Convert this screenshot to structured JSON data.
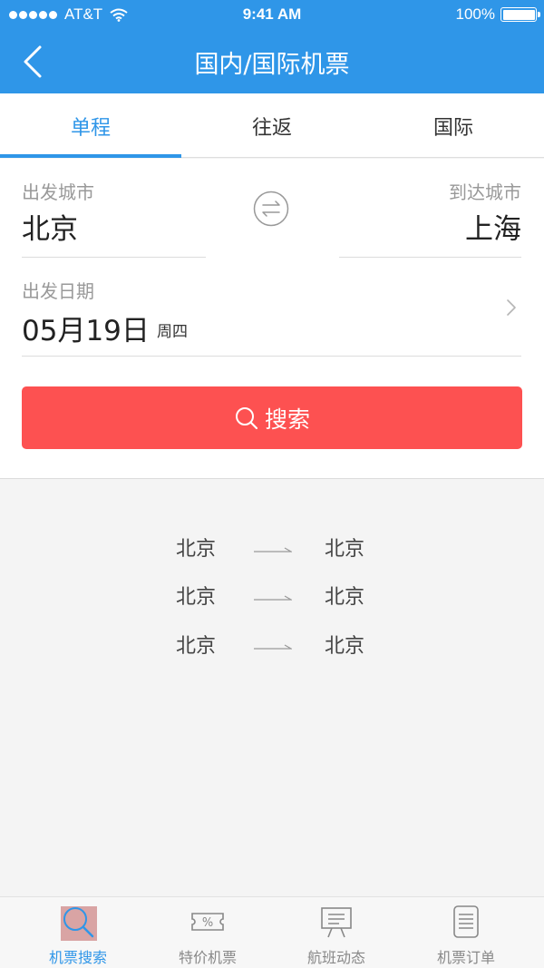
{
  "status_bar": {
    "carrier": "AT&T",
    "time": "9:41 AM",
    "battery": "100%"
  },
  "nav": {
    "title": "国内/国际机票"
  },
  "tabs": [
    {
      "label": "单程",
      "active": true
    },
    {
      "label": "往返",
      "active": false
    },
    {
      "label": "国际",
      "active": false
    }
  ],
  "form": {
    "from_label": "出发城市",
    "from_city": "北京",
    "to_label": "到达城市",
    "to_city": "上海",
    "date_label": "出发日期",
    "date": "05月19日",
    "weekday": "周四",
    "search_label": "搜索"
  },
  "history": [
    {
      "from": "北京",
      "to": "北京"
    },
    {
      "from": "北京",
      "to": "北京"
    },
    {
      "from": "北京",
      "to": "北京"
    }
  ],
  "tabbar": [
    {
      "label": "机票搜索",
      "icon": "search-icon",
      "active": true
    },
    {
      "label": "特价机票",
      "icon": "discount-ticket-icon",
      "active": false
    },
    {
      "label": "航班动态",
      "icon": "flight-board-icon",
      "active": false
    },
    {
      "label": "机票订单",
      "icon": "order-list-icon",
      "active": false
    }
  ],
  "colors": {
    "primary": "#2f96e8",
    "search_button": "#fd5151",
    "background": "#f4f4f4"
  }
}
